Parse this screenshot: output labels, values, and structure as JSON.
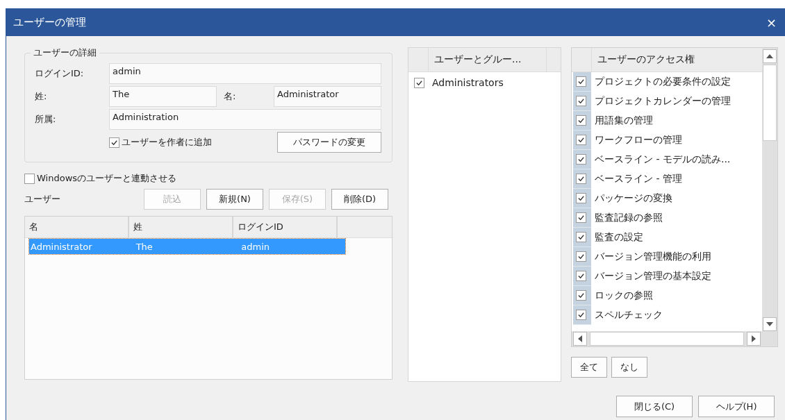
{
  "window": {
    "title": "ユーザーの管理",
    "close": "×"
  },
  "user_details": {
    "title": "ユーザーの詳細",
    "login_id": {
      "label": "ログインID:",
      "value": "admin"
    },
    "last_name": {
      "label": "姓:",
      "value": "The"
    },
    "first_name": {
      "label": "名:",
      "value": "Administrator"
    },
    "department": {
      "label": "所属:",
      "value": "Administration"
    },
    "add_author": {
      "label": "ユーザーを作者に追加",
      "checked": true
    },
    "password_button": "パスワードの変更"
  },
  "sync_windows": {
    "label": "Windowsのユーザーと連動させる",
    "checked": false
  },
  "users": {
    "label": "ユーザー",
    "buttons": [
      {
        "label": "読込",
        "disabled": true
      },
      {
        "label": "新規(N)",
        "disabled": false
      },
      {
        "label": "保存(S)",
        "disabled": true
      },
      {
        "label": "削除(D)",
        "disabled": false
      }
    ],
    "columns": [
      "名",
      "姓",
      "ログインID"
    ],
    "rows": [
      {
        "cells": [
          "Administrator",
          "The",
          "admin"
        ],
        "selected": true
      }
    ]
  },
  "groups": {
    "header": "ユーザーとグルー...",
    "items": [
      {
        "label": "Administrators",
        "checked": true
      }
    ]
  },
  "permissions": {
    "header": "ユーザーのアクセス権",
    "items": [
      {
        "label": "プロジェクトの必要条件の設定",
        "checked": true
      },
      {
        "label": "プロジェクトカレンダーの管理",
        "checked": true
      },
      {
        "label": "用語集の管理",
        "checked": true
      },
      {
        "label": "ワークフローの管理",
        "checked": true
      },
      {
        "label": "ベースライン - モデルの読み...",
        "checked": true
      },
      {
        "label": "ベースライン - 管理",
        "checked": true
      },
      {
        "label": "パッケージの変換",
        "checked": true
      },
      {
        "label": "監査記録の参照",
        "checked": true
      },
      {
        "label": "監査の設定",
        "checked": true
      },
      {
        "label": "バージョン管理機能の利用",
        "checked": true
      },
      {
        "label": "バージョン管理の基本設定",
        "checked": true
      },
      {
        "label": "ロックの参照",
        "checked": true
      },
      {
        "label": "スペルチェック",
        "checked": true
      }
    ],
    "buttons": [
      "全て",
      "なし"
    ]
  },
  "footer_buttons": [
    "閉じる(C)",
    "ヘルプ(H)"
  ]
}
